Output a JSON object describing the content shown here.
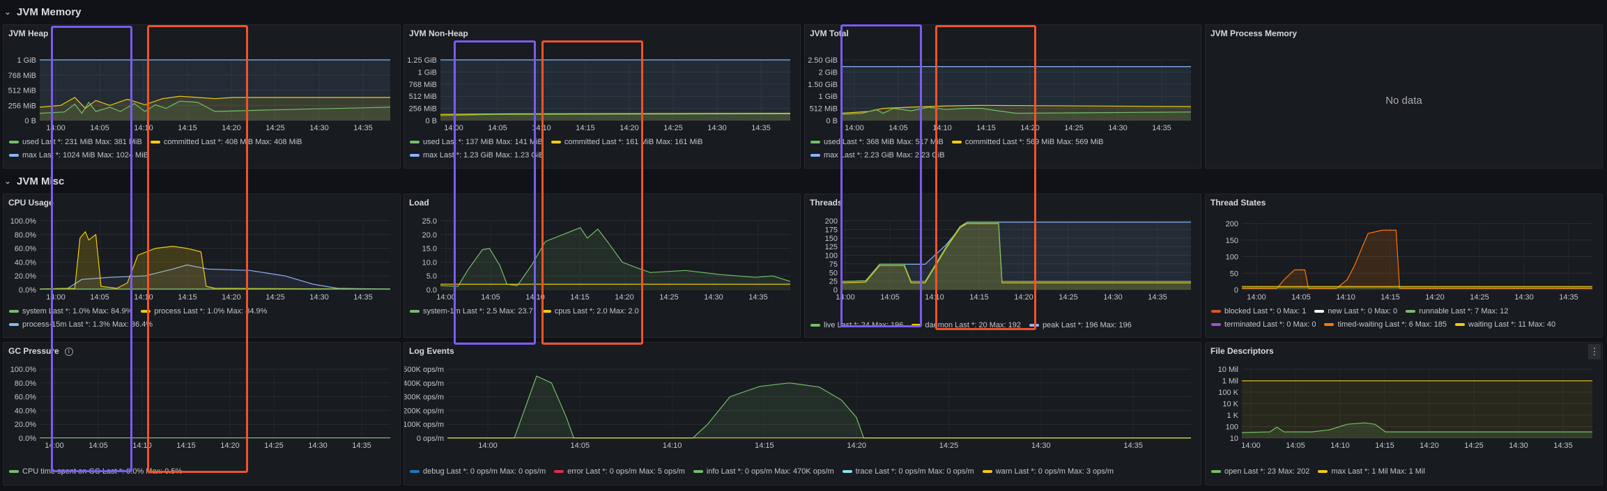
{
  "rows": {
    "jvm_memory": "JVM Memory",
    "jvm_misc": "JVM Misc"
  },
  "panels": {
    "jvm_heap": {
      "title": "JVM Heap",
      "yticks": [
        "1 GiB",
        "768 MiB",
        "512 MiB",
        "256 MiB",
        "0 B"
      ],
      "legend": [
        {
          "name": "used",
          "text": "Last *: 231 MiB  Max: 381 MiB",
          "color": "#73bf69"
        },
        {
          "name": "committed",
          "text": "Last *: 408 MiB  Max: 408 MiB",
          "color": "#f2cc0c"
        },
        {
          "name": "max",
          "text": "Last *: 1024 MiB  Max: 1024 MiB",
          "color": "#8ab8ff"
        }
      ]
    },
    "jvm_nonheap": {
      "title": "JVM Non-Heap",
      "yticks": [
        "1.25 GiB",
        "1 GiB",
        "768 MiB",
        "512 MiB",
        "256 MiB",
        "0 B"
      ],
      "legend": [
        {
          "name": "used",
          "text": "Last *: 137 MiB  Max: 141 MiB",
          "color": "#73bf69"
        },
        {
          "name": "committed",
          "text": "Last *: 161 MiB  Max: 161 MiB",
          "color": "#f2cc0c"
        },
        {
          "name": "max",
          "text": "Last *: 1.23 GiB  Max: 1.23 GiB",
          "color": "#8ab8ff"
        }
      ]
    },
    "jvm_total": {
      "title": "JVM Total",
      "yticks": [
        "2.50 GiB",
        "2 GiB",
        "1.50 GiB",
        "1 GiB",
        "512 MiB",
        "0 B"
      ],
      "legend": [
        {
          "name": "used",
          "text": "Last *: 368 MiB  Max: 517 MiB",
          "color": "#73bf69"
        },
        {
          "name": "committed",
          "text": "Last *: 569 MiB  Max: 569 MiB",
          "color": "#f2cc0c"
        },
        {
          "name": "max",
          "text": "Last *: 2.23 GiB  Max: 2.23 GiB",
          "color": "#8ab8ff"
        }
      ]
    },
    "jvm_process_memory": {
      "title": "JVM Process Memory",
      "nodata": "No data"
    },
    "cpu_usage": {
      "title": "CPU Usage",
      "yticks": [
        "100.0%",
        "80.0%",
        "60.0%",
        "40.0%",
        "20.0%",
        "0.0%"
      ],
      "legend": [
        {
          "name": "system",
          "text": "Last *: 1.0%  Max: 84.9%",
          "color": "#73bf69"
        },
        {
          "name": "process",
          "text": "Last *: 1.0%  Max: 84.9%",
          "color": "#f2cc0c"
        },
        {
          "name": "process-15m",
          "text": "Last *: 1.3%  Max: 36.4%",
          "color": "#8ab8ff"
        }
      ]
    },
    "load": {
      "title": "Load",
      "yticks": [
        "25.0",
        "20.0",
        "15.0",
        "10.0",
        "5.0",
        "0.0"
      ],
      "legend": [
        {
          "name": "system-1m",
          "text": "Last *: 2.5  Max: 23.7",
          "color": "#73bf69"
        },
        {
          "name": "cpus",
          "text": "Last *: 2.0  Max: 2.0",
          "color": "#f2cc0c"
        }
      ]
    },
    "threads": {
      "title": "Threads",
      "yticks": [
        "200",
        "175",
        "150",
        "125",
        "100",
        "75",
        "50",
        "25",
        "0"
      ],
      "legend": [
        {
          "name": "live",
          "text": "Last *: 24  Max: 196",
          "color": "#73bf69"
        },
        {
          "name": "daemon",
          "text": "Last *: 20  Max: 192",
          "color": "#f2cc0c"
        },
        {
          "name": "peak",
          "text": "Last *: 196  Max: 196",
          "color": "#8ab8ff"
        }
      ]
    },
    "thread_states": {
      "title": "Thread States",
      "yticks": [
        "200",
        "150",
        "100",
        "50",
        "0"
      ],
      "legend": [
        {
          "name": "blocked",
          "text": "Last *: 0  Max: 1",
          "color": "#e0502b"
        },
        {
          "name": "new",
          "text": "Last *: 0  Max: 0",
          "color": "#ffffff"
        },
        {
          "name": "runnable",
          "text": "Last *: 7  Max: 12",
          "color": "#73bf69"
        },
        {
          "name": "terminated",
          "text": "Last *: 0  Max: 0",
          "color": "#a352cc"
        },
        {
          "name": "timed-waiting",
          "text": "Last *: 6  Max: 185",
          "color": "#ff780a"
        },
        {
          "name": "waiting",
          "text": "Last *: 11  Max: 40",
          "color": "#f2cc0c"
        }
      ]
    },
    "gc_pressure": {
      "title": "GC Pressure",
      "yticks": [
        "100.0%",
        "80.0%",
        "60.0%",
        "40.0%",
        "20.0%",
        "0.0%"
      ],
      "legend": [
        {
          "name": "CPU time spent on GC",
          "text": "Last *: 0.0%  Max: 0.5%",
          "color": "#73bf69"
        }
      ]
    },
    "log_events": {
      "title": "Log Events",
      "yticks": [
        "500K ops/m",
        "400K ops/m",
        "300K ops/m",
        "200K ops/m",
        "100K ops/m",
        "0 ops/m"
      ],
      "legend": [
        {
          "name": "debug",
          "text": "Last *: 0 ops/m  Max: 0 ops/m",
          "color": "#1f78c1"
        },
        {
          "name": "error",
          "text": "Last *: 0 ops/m  Max: 5 ops/m",
          "color": "#e02f44"
        },
        {
          "name": "info",
          "text": "Last *: 0 ops/m  Max: 470K ops/m",
          "color": "#73bf69"
        },
        {
          "name": "trace",
          "text": "Last *: 0 ops/m  Max: 0 ops/m",
          "color": "#8ae1f5"
        },
        {
          "name": "warn",
          "text": "Last *: 0 ops/m  Max: 3 ops/m",
          "color": "#f2cc0c"
        }
      ]
    },
    "file_descriptors": {
      "title": "File Descriptors",
      "yticks": [
        "10 Mil",
        "1 Mil",
        "100 K",
        "10 K",
        "1 K",
        "100",
        "10"
      ],
      "legend": [
        {
          "name": "open",
          "text": "Last *: 23  Max: 202",
          "color": "#73bf69"
        },
        {
          "name": "max",
          "text": "Last *: 1 Mil  Max: 1 Mil",
          "color": "#f2cc0c"
        }
      ]
    }
  },
  "xticks": [
    "14:00",
    "14:05",
    "14:10",
    "14:15",
    "14:20",
    "14:25",
    "14:30",
    "14:35"
  ],
  "icons": {
    "chevron": "chevron-down-icon",
    "info": "info-icon",
    "menu": "panel-menu-icon"
  },
  "menu_glyph": "⋮",
  "chevron_glyph": "⌄",
  "info_glyph": "i",
  "highlight_colors": {
    "purple": "#7b5cf0",
    "red": "#f0532b"
  }
}
